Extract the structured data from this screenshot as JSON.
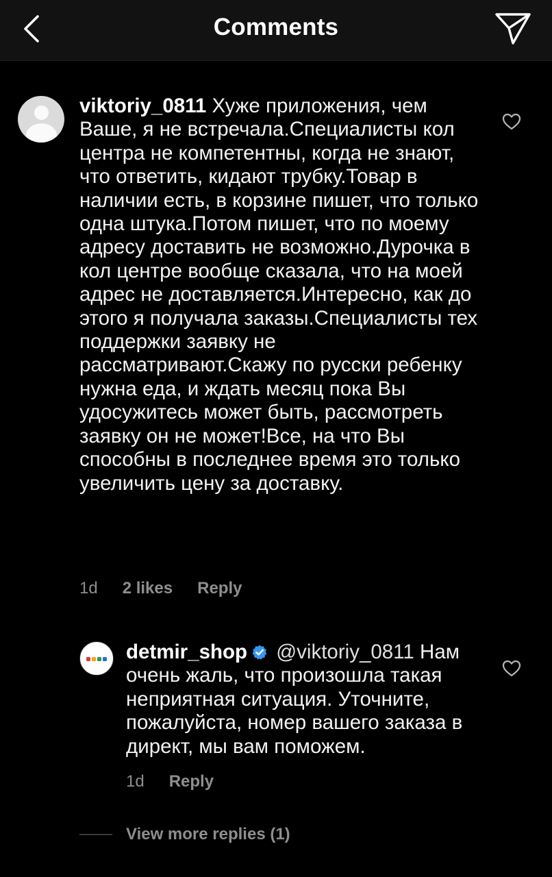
{
  "header": {
    "title": "Comments",
    "back_icon": "chevron-left-icon",
    "share_icon": "paper-plane-icon"
  },
  "comment": {
    "username": "viktoriy_0811",
    "text": "Хуже приложения, чем Ваше, я не встречала.Специалисты кол центра не компетентны, когда не знают, что ответить, кидают трубку.Товар в наличии есть, в корзине пишет, что только одна штука.Потом пишет, что по моему адресу доставить не возможно.Дурочка в кол центре вообще сказала, что на моей адрес не доставляется.Интересно, как до этого я получала заказы.Специалисты тех поддержки заявку не рассматривают.Скажу по русски ребенку нужна еда, и ждать месяц пока Вы удосужитесь может быть, рассмотреть заявку он не может!Все, на что Вы способны в последнее время это только увеличить цену за доставку.",
    "time": "1d",
    "likes": "2 likes",
    "reply_label": "Reply"
  },
  "reply": {
    "username": "detmir_shop",
    "mention": "@viktoriy_0811",
    "text": "Нам очень жаль, что произошла такая неприятная ситуация. Уточните, пожалуйста, номер вашего заказа в директ, мы вам поможем.",
    "time": "1d",
    "reply_label": "Reply",
    "avatar_colors": [
      "#e5383b",
      "#f3a712",
      "#2a9d4a",
      "#2b6fd6"
    ]
  },
  "view_more": {
    "label": "View more replies (1)"
  },
  "colors": {
    "background": "#000000",
    "header": "#121212",
    "muted": "#8e8e8e",
    "verified": "#3897f0"
  }
}
